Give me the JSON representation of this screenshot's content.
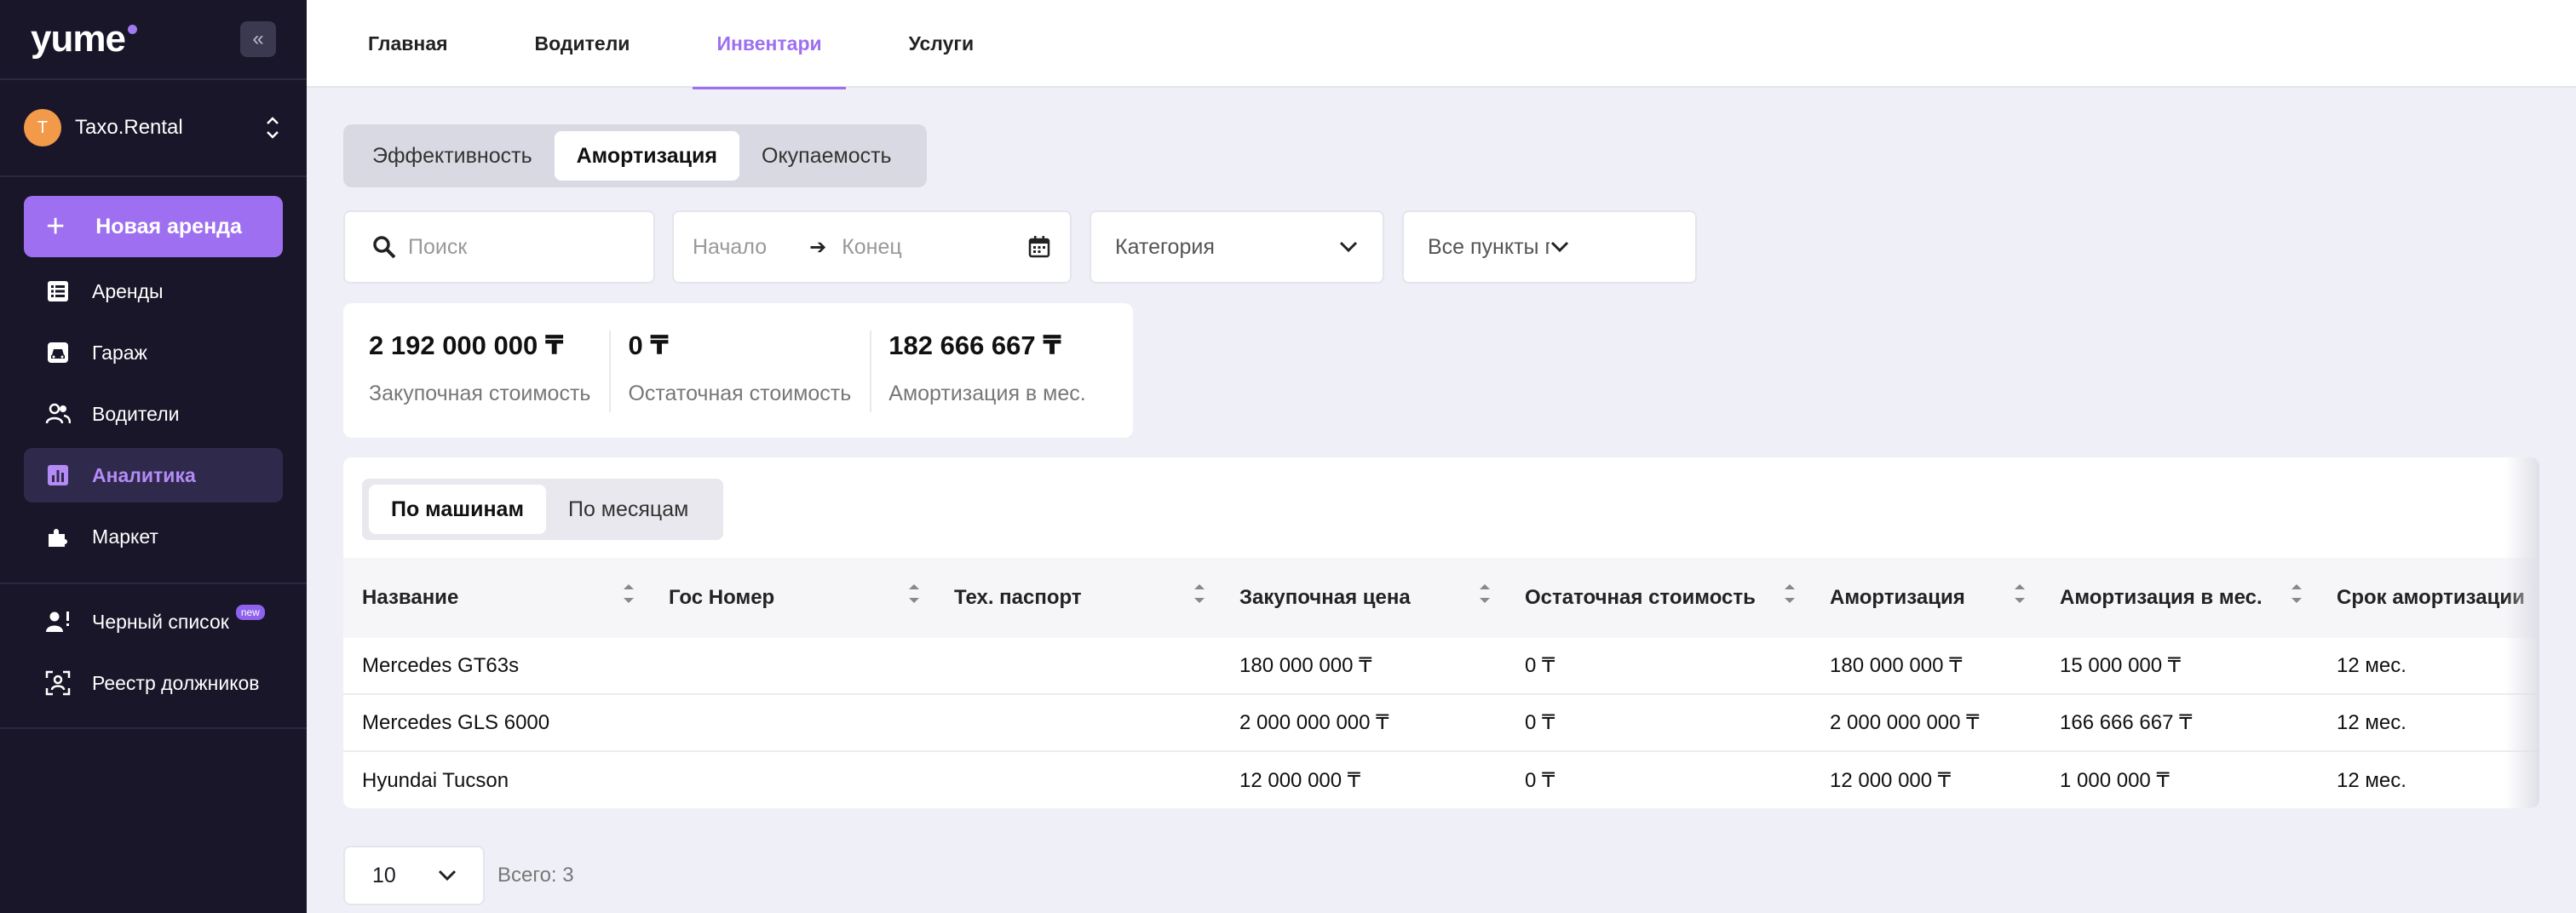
{
  "sidebar": {
    "logo": "yume",
    "company": {
      "initial": "T",
      "name": "Taxo.Rental"
    },
    "new_rent": "Новая аренда",
    "items": [
      {
        "label": "Аренды",
        "icon": "list-icon"
      },
      {
        "label": "Гараж",
        "icon": "car-icon"
      },
      {
        "label": "Водители",
        "icon": "users-icon"
      },
      {
        "label": "Аналитика",
        "icon": "chart-icon",
        "active": true
      },
      {
        "label": "Маркет",
        "icon": "puzzle-icon"
      }
    ],
    "items2": [
      {
        "label": "Черный список",
        "icon": "user-alert-icon",
        "badge": "new"
      },
      {
        "label": "Реестр должников",
        "icon": "scan-user-icon"
      }
    ]
  },
  "topnav": {
    "tabs": [
      "Главная",
      "Водители",
      "Инвентари",
      "Услуги"
    ],
    "active": "Инвентари"
  },
  "segment": {
    "items": [
      "Эффективность",
      "Амортизация",
      "Окупаемость"
    ],
    "active": "Амортизация"
  },
  "filters": {
    "search_placeholder": "Поиск",
    "start_placeholder": "Начало",
    "end_placeholder": "Конец",
    "category_placeholder": "Категория",
    "points_placeholder": "Все пункты проката"
  },
  "stats": [
    {
      "value": "2 192 000 000 ₸",
      "label": "Закупочная стоимость"
    },
    {
      "value": "0 ₸",
      "label": "Остаточная стоимость"
    },
    {
      "value": "182 666 667 ₸",
      "label": "Амортизация в мес."
    }
  ],
  "table": {
    "view_tabs": [
      "По машинам",
      "По месяцам"
    ],
    "active_view": "По машинам",
    "columns": [
      "Название",
      "Гос Номер",
      "Тех. паспорт",
      "Закупочная цена",
      "Остаточная стоимость",
      "Амортизация",
      "Амортизация в мес.",
      "Срок амортизации"
    ],
    "rows": [
      [
        "Mercedes GT63s",
        "",
        "",
        "180 000 000 ₸",
        "0 ₸",
        "180 000 000 ₸",
        "15 000 000 ₸",
        "12 мес."
      ],
      [
        "Mercedes GLS 6000",
        "",
        "",
        "2 000 000 000 ₸",
        "0 ₸",
        "2 000 000 000 ₸",
        "166 666 667 ₸",
        "12 мес."
      ],
      [
        "Hyundai Tucson",
        "",
        "",
        "12 000 000 ₸",
        "0 ₸",
        "12 000 000 ₸",
        "1 000 000 ₸",
        "12 мес."
      ]
    ]
  },
  "pagination": {
    "page_size": "10",
    "total": "Всего: 3"
  },
  "colors": {
    "accent": "#9e6ff0",
    "sidebar_bg": "#181628",
    "page_bg": "#eff0f7"
  }
}
